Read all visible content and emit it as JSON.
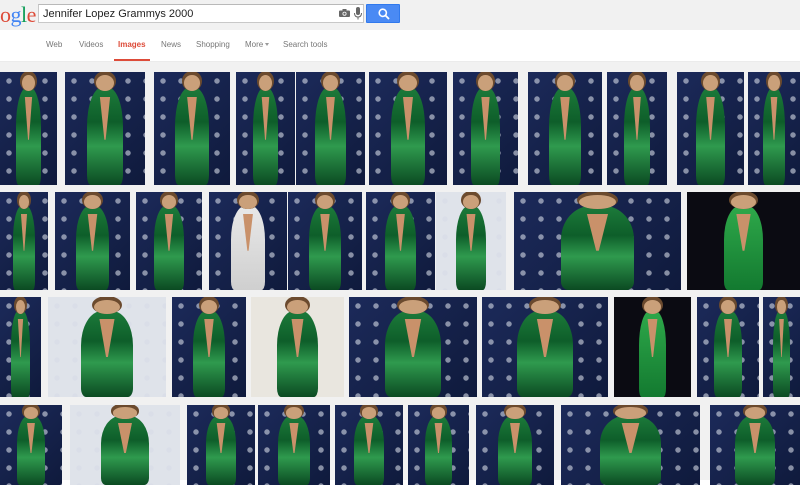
{
  "search": {
    "query": "Jennifer Lopez Grammys 2000",
    "button_icon": "search-icon"
  },
  "logo": {
    "text": "ogle",
    "letters": [
      {
        "ch": "o",
        "color": "#dd4b39"
      },
      {
        "ch": "g",
        "color": "#4285f4"
      },
      {
        "ch": "l",
        "color": "#0f9d58"
      },
      {
        "ch": "e",
        "color": "#dd4b39"
      }
    ]
  },
  "nav": {
    "tabs": [
      {
        "label": "Web",
        "active": false
      },
      {
        "label": "Videos",
        "active": false
      },
      {
        "label": "Images",
        "active": true
      },
      {
        "label": "News",
        "active": false
      },
      {
        "label": "Shopping",
        "active": false
      },
      {
        "label": "More",
        "active": false
      },
      {
        "label": "Search tools",
        "active": false
      }
    ]
  },
  "colors": {
    "accent": "#dd4b39",
    "search_button": "#4a8af4"
  },
  "results": {
    "thumbnail_count": 41,
    "description_note": "Grid of image search result thumbnails"
  }
}
